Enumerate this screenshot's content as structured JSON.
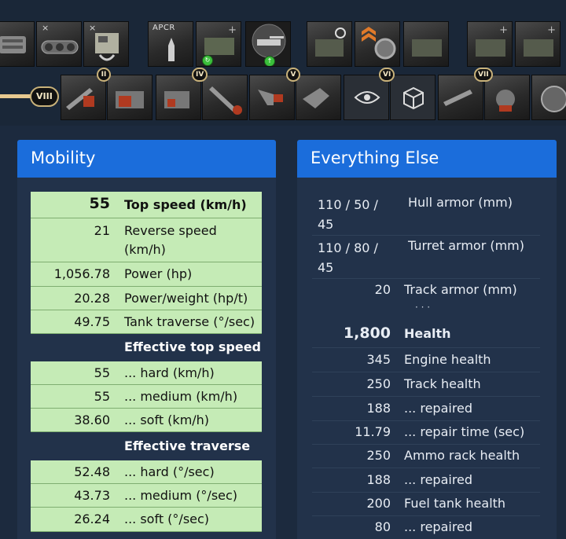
{
  "equipment": {
    "shell_label": "APCR"
  },
  "tiers": [
    "II",
    "IV",
    "V",
    "VI",
    "VII",
    "VIII"
  ],
  "mobility": {
    "title": "Mobility",
    "main": [
      {
        "value": "55",
        "label": "Top speed (km/h)"
      },
      {
        "value": "21",
        "label": "Reverse speed (km/h)"
      },
      {
        "value": "1,056.78",
        "label": "Power (hp)"
      },
      {
        "value": "20.28",
        "label": "Power/weight (hp/t)"
      },
      {
        "value": "49.75",
        "label": "Tank traverse (°/sec)"
      }
    ],
    "speed_header": "Effective top speed",
    "speed": [
      {
        "value": "55",
        "label": "... hard (km/h)"
      },
      {
        "value": "55",
        "label": "... medium (km/h)"
      },
      {
        "value": "38.60",
        "label": "... soft (km/h)"
      }
    ],
    "traverse_header": "Effective traverse",
    "traverse": [
      {
        "value": "52.48",
        "label": "... hard (°/sec)"
      },
      {
        "value": "43.73",
        "label": "... medium (°/sec)"
      },
      {
        "value": "26.24",
        "label": "... soft (°/sec)"
      }
    ]
  },
  "else": {
    "title": "Everything Else",
    "armor": [
      {
        "value": "110 / 50 / 45",
        "label": "Hull armor (mm)"
      },
      {
        "value": "110 / 80 / 45",
        "label": "Turret armor (mm)"
      },
      {
        "value": "20",
        "label": "Track armor (mm)"
      }
    ],
    "ellipsis": "· · ·",
    "health_value": "1,800",
    "health_label": "Health",
    "rows": [
      {
        "value": "345",
        "label": "Engine health"
      },
      {
        "value": "250",
        "label": "Track health"
      },
      {
        "value": "188",
        "label": "... repaired"
      },
      {
        "value": "11.79",
        "label": "... repair time (sec)"
      },
      {
        "value": "250",
        "label": "Ammo rack health"
      },
      {
        "value": "188",
        "label": "... repaired"
      },
      {
        "value": "200",
        "label": "Fuel tank health"
      },
      {
        "value": "80",
        "label": "... repaired"
      }
    ]
  }
}
